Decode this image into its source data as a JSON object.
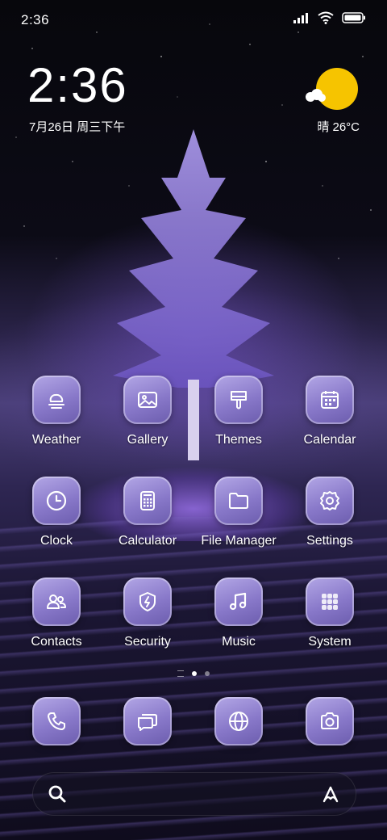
{
  "status_bar": {
    "time": "2:36"
  },
  "clock_widget": {
    "time": "2:36",
    "date": "7月26日 周三下午"
  },
  "weather_widget": {
    "text": "晴 26°C",
    "icon": "sun-cloud-icon"
  },
  "apps": [
    {
      "label": "Weather",
      "icon": "weather-icon"
    },
    {
      "label": "Gallery",
      "icon": "gallery-icon"
    },
    {
      "label": "Themes",
      "icon": "brush-icon"
    },
    {
      "label": "Calendar",
      "icon": "calendar-icon"
    },
    {
      "label": "Clock",
      "icon": "clock-icon"
    },
    {
      "label": "Calculator",
      "icon": "calculator-icon"
    },
    {
      "label": "File Manager",
      "icon": "folder-icon"
    },
    {
      "label": "Settings",
      "icon": "gear-icon"
    },
    {
      "label": "Contacts",
      "icon": "contacts-icon"
    },
    {
      "label": "Security",
      "icon": "shield-icon"
    },
    {
      "label": "Music",
      "icon": "music-icon"
    },
    {
      "label": "System",
      "icon": "folder-grid-icon"
    }
  ],
  "dock": [
    {
      "icon": "phone-icon"
    },
    {
      "icon": "messages-icon"
    },
    {
      "icon": "browser-icon"
    },
    {
      "icon": "camera-icon"
    }
  ],
  "page_indicator": {
    "pages": 2,
    "active": 1
  },
  "colors": {
    "tile": "#8878c9",
    "sun": "#f6c400"
  }
}
